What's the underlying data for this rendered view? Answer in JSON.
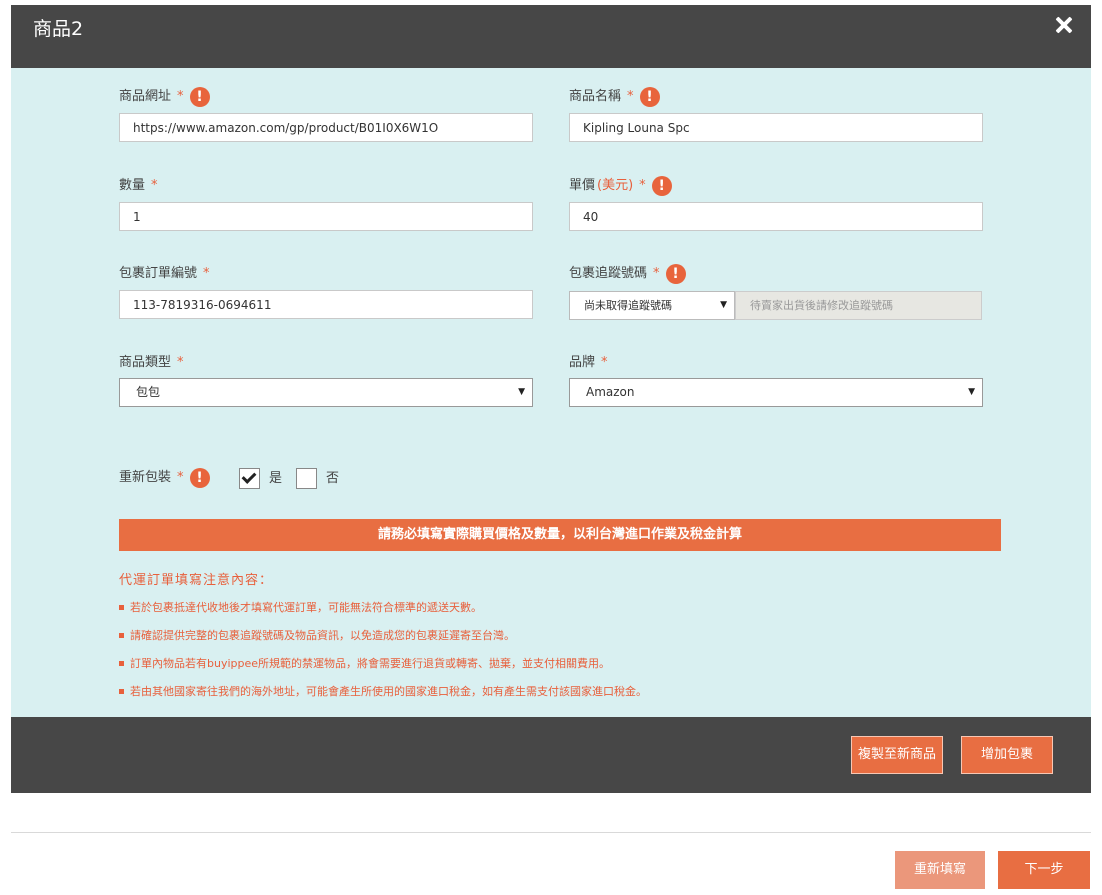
{
  "modal": {
    "title": "商品2",
    "close_icon": "close-icon"
  },
  "form": {
    "product_url": {
      "label": "商品網址",
      "required": "*",
      "value": "https://www.amazon.com/gp/product/B01I0X6W1O"
    },
    "product_name": {
      "label": "商品名稱",
      "required": "*",
      "value": "Kipling Louna Spc"
    },
    "quantity": {
      "label": "數量",
      "required": "*",
      "value": "1"
    },
    "unit_price": {
      "label": "單價",
      "label_unit": "(美元)",
      "required": "*",
      "value": "40"
    },
    "order_number": {
      "label": "包裹訂單編號",
      "required": "*",
      "value": "113-7819316-0694611"
    },
    "tracking_number": {
      "label": "包裹追蹤號碼",
      "required": "*",
      "selected": "尚未取得追蹤號碼",
      "note": "待賣家出貨後請修改追蹤號碼"
    },
    "category": {
      "label": "商品類型",
      "required": "*",
      "selected": "包包"
    },
    "brand": {
      "label": "品牌",
      "required": "*",
      "selected": "Amazon"
    },
    "repack": {
      "label": "重新包裝",
      "required": "*",
      "options": [
        {
          "label": "是",
          "checked": true
        },
        {
          "label": "否",
          "checked": false
        }
      ]
    }
  },
  "banner": "請務必填寫實際購買價格及數量，以利台灣進口作業及稅金計算",
  "notes": {
    "title": "代運訂單填寫注意內容：",
    "items": [
      "若於包裹抵達代收地後才填寫代運訂單，可能無法符合標準的遞送天數。",
      "請確認提供完整的包裹追蹤號碼及物品資訊，以免造成您的包裹延遲寄至台灣。",
      "訂單內物品若有buyippee所規範的禁運物品，將會需要進行退貨或轉寄、拋棄，並支付相關費用。",
      "若由其他國家寄往我們的海外地址，可能會產生所使用的國家進口稅金，如有產生需支付該國家進口稅金。"
    ]
  },
  "footer": {
    "copy_label": "複製至新商品",
    "add_package_label": "增加包裹"
  },
  "page_actions": {
    "reset_label": "重新填寫",
    "next_label": "下一步"
  },
  "colors": {
    "accent": "#e86e42",
    "header_bg": "#474747",
    "form_bg": "#d9f0f1"
  }
}
